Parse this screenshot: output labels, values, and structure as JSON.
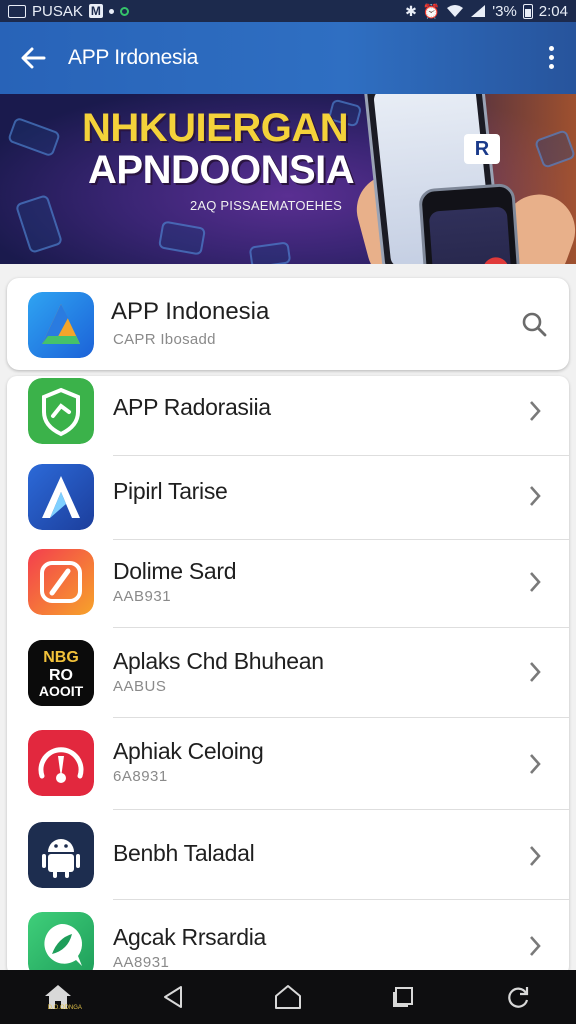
{
  "status_bar": {
    "carrier": "PUSAK",
    "battery": "'3%",
    "time": "2:04"
  },
  "app_bar": {
    "title": "APP Irdonesia"
  },
  "banner": {
    "headline_1": "NHKUIERGAN",
    "headline_2": "APNDOONSIA",
    "subline": "2AQ PISSAEMATOEHES",
    "phone_logo_text": "R"
  },
  "search_card": {
    "title": "APP Indonesia",
    "subtitle": "CAPR Ibosadd",
    "icon": "app-a-icon"
  },
  "apps": [
    {
      "title": "APP Radorasiia",
      "subtitle": "",
      "icon": "shield-icon"
    },
    {
      "title": "Pipirl Tarise",
      "subtitle": "",
      "icon": "a-logo-icon"
    },
    {
      "title": "Dolime Sard",
      "subtitle": "AAB931",
      "icon": "brush-icon"
    },
    {
      "title": "Aplaks Chd Bhuhean",
      "subtitle": "AABUS",
      "icon": "text-badge-icon",
      "icon_text": "NBG RO AOOIT"
    },
    {
      "title": "Aphiak Celoing",
      "subtitle": "6A8931",
      "icon": "gauge-icon"
    },
    {
      "title": "Benbh Taladal",
      "subtitle": "",
      "icon": "android-icon"
    },
    {
      "title": "Agcak Rrsardia",
      "subtitle": "AA8931",
      "icon": "chat-leaf-icon"
    }
  ],
  "nav_bar": {
    "home_caption": "D.O.ODNGA"
  }
}
